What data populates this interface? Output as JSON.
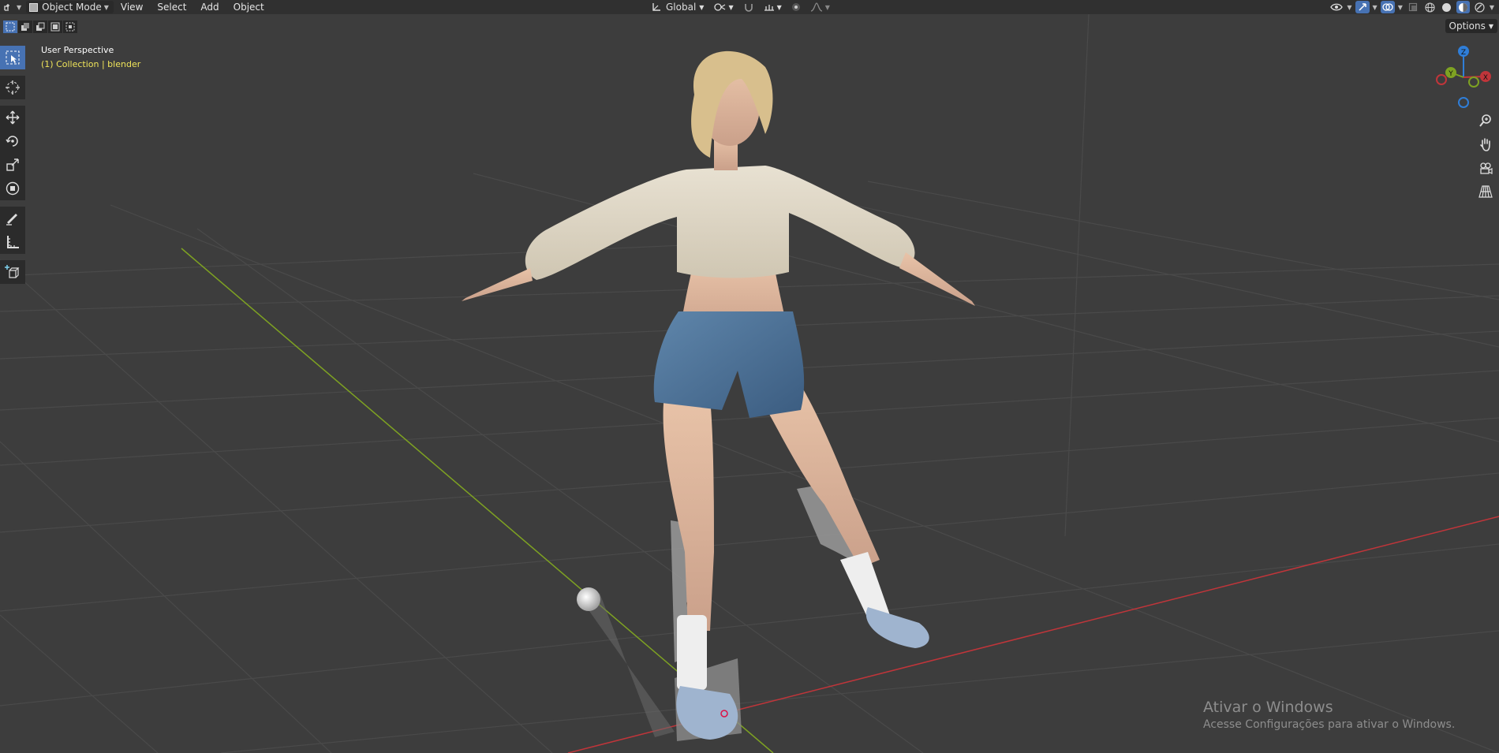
{
  "header": {
    "mode": "Object Mode",
    "menus": [
      "View",
      "Select",
      "Add",
      "Object"
    ],
    "orientation": "Global"
  },
  "options_label": "Options",
  "viewport": {
    "view_name": "User Perspective",
    "collection": "(1) Collection | blender"
  },
  "gizmo": {
    "x": "X",
    "y": "Y",
    "z": "Z"
  },
  "watermark": {
    "title": "Ativar o Windows",
    "subtitle": "Acesse Configurações para ativar o Windows."
  },
  "colors": {
    "accent": "#4772b3",
    "header_bg": "#303030",
    "viewport_bg": "#3d3d3d",
    "x_axis": "#c0353a",
    "y_axis": "#7ea222",
    "z_axis": "#2f7ed8",
    "collection_text": "#f0e55a"
  }
}
